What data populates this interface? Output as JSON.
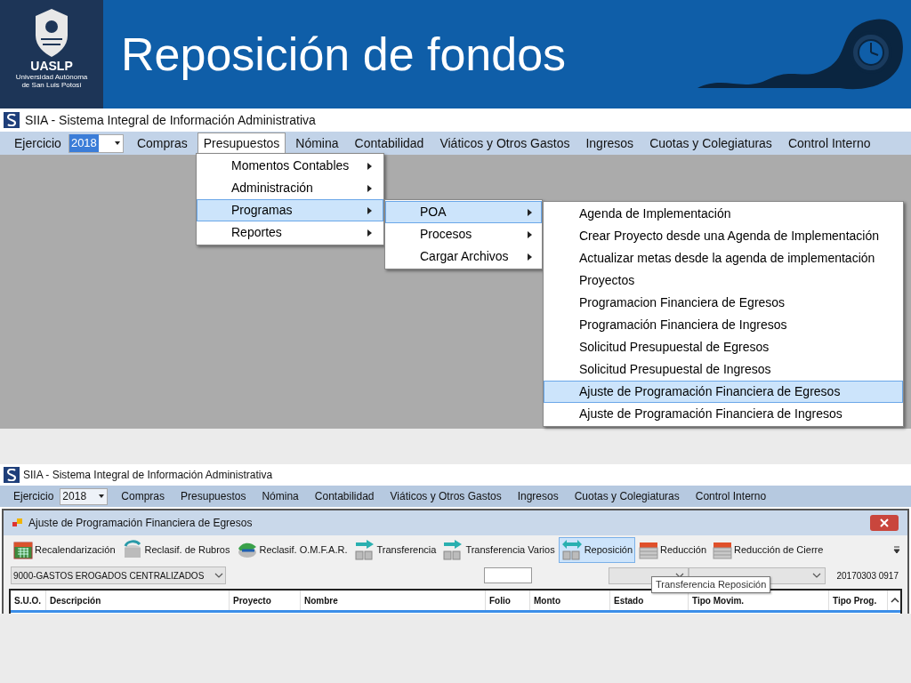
{
  "slide": {
    "title": "Reposición de fondos",
    "logo": {
      "acronym": "UASLP",
      "name_lines": [
        "Universidad Autónoma",
        "de San Luis Potosí"
      ]
    }
  },
  "screen_1": {
    "app_title": "SIIA - Sistema Integral de Información Administrativa",
    "year_label": "Ejercicio",
    "year": "2018",
    "menus": [
      {
        "label": "Compras",
        "selected": false
      },
      {
        "label": "Presupuestos",
        "selected": true
      },
      {
        "label": "Nómina",
        "selected": false
      },
      {
        "label": "Contabilidad",
        "selected": false
      },
      {
        "label": "Viáticos y Otros Gastos",
        "selected": false
      },
      {
        "label": "Ingresos",
        "selected": false
      },
      {
        "label": "Cuotas y Colegiaturas",
        "selected": false
      },
      {
        "label": "Control Interno",
        "selected": false
      }
    ],
    "submenu_1": [
      {
        "label": "Momentos Contables",
        "selected": false
      },
      {
        "label": "Administración",
        "selected": false
      },
      {
        "label": "Programas",
        "selected": true
      },
      {
        "label": "Reportes",
        "selected": false
      }
    ],
    "submenu_2": [
      {
        "label": "POA",
        "selected": true
      },
      {
        "label": "Procesos",
        "selected": false
      },
      {
        "label": "Cargar Archivos",
        "selected": false
      }
    ],
    "submenu_3": [
      {
        "label": "Agenda de Implementación",
        "selected": false
      },
      {
        "label": "Crear Proyecto desde una Agenda de Implementación",
        "selected": false
      },
      {
        "label": "Actualizar metas desde la agenda de implementación",
        "selected": false
      },
      {
        "label": "Proyectos",
        "selected": false
      },
      {
        "label": "Programacion Financiera de Egresos",
        "selected": false
      },
      {
        "label": "Programación Financiera de Ingresos",
        "selected": false
      },
      {
        "label": "Solicitud Presupuestal de Egresos",
        "selected": false
      },
      {
        "label": "Solicitud Presupuestal de Ingresos",
        "selected": false
      },
      {
        "label": "Ajuste de Programación Financiera de Egresos",
        "selected": true
      },
      {
        "label": "Ajuste de Programación Financiera de Ingresos",
        "selected": false
      }
    ]
  },
  "screen_2": {
    "app_title": "SIIA - Sistema Integral de Información Administrativa",
    "year_label": "Ejercicio",
    "year": "2018",
    "menus": [
      "Compras",
      "Presupuestos",
      "Nómina",
      "Contabilidad",
      "Viáticos y Otros Gastos",
      "Ingresos",
      "Cuotas y Colegiaturas",
      "Control Interno"
    ],
    "window_title": "Ajuste de Programación Financiera de Egresos",
    "toolbar": [
      {
        "label": "Recalendarización",
        "kind": "calendar",
        "selected": false
      },
      {
        "label": "Reclasif. de Rubros",
        "kind": "cycle",
        "selected": false
      },
      {
        "label": "Reclasif. O.M.F.A.R.",
        "kind": "green",
        "selected": false
      },
      {
        "label": "Transferencia",
        "kind": "arrow",
        "selected": false
      },
      {
        "label": "Transferencia Varios",
        "kind": "arrow",
        "selected": false
      },
      {
        "label": "Reposición",
        "kind": "swap",
        "selected": true
      },
      {
        "label": "Reducción",
        "kind": "stack",
        "selected": false
      },
      {
        "label": "Reducción de Cierre",
        "kind": "stack",
        "selected": false
      }
    ],
    "filter_value": "9000-GASTOS EROGADOS CENTRALIZADOS",
    "date_code": "20170303 0917",
    "tooltip": "Transferencia Reposición",
    "columns": [
      "S.U.O.",
      "Descripción",
      "Proyecto",
      "Nombre",
      "Folio",
      "Monto",
      "Estado",
      "Tipo Movim.",
      "Tipo Prog."
    ]
  }
}
